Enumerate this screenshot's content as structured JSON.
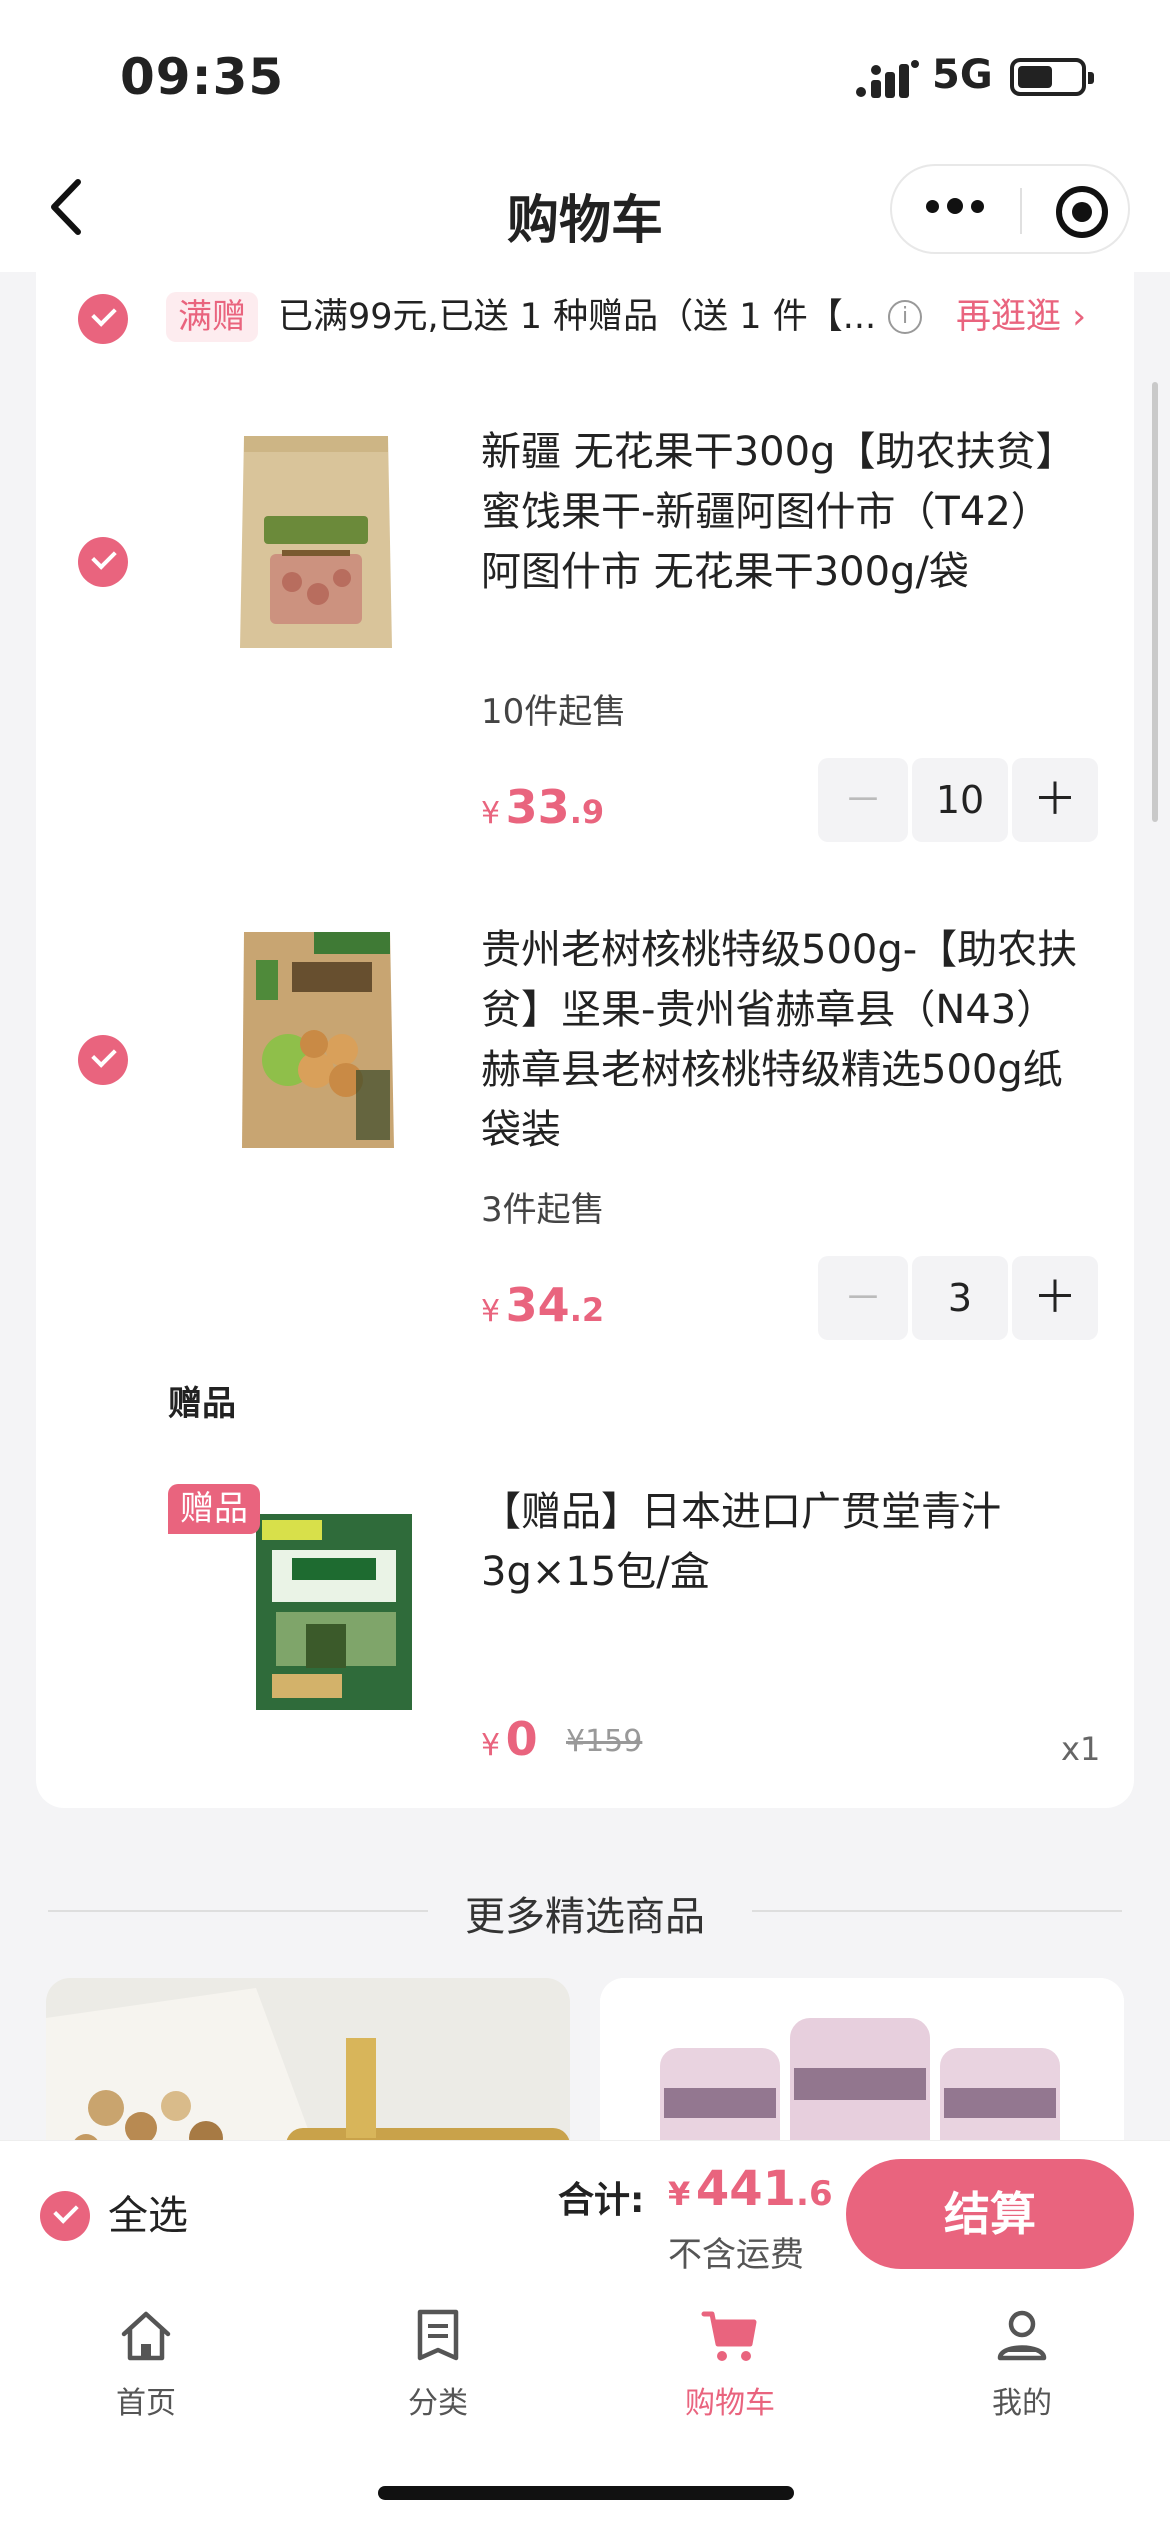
{
  "status_bar": {
    "time": "09:35",
    "network": "5G"
  },
  "nav": {
    "title": "购物车"
  },
  "promo": {
    "tag": "满赠",
    "text": "已满99元,已送 1 种赠品（送 1 件【...",
    "more": "再逛逛"
  },
  "items": [
    {
      "title": "新疆 无花果干300g【助农扶贫】蜜饯果干-新疆阿图什市（T42） 阿图什市 无花果干300g/袋",
      "min_qty": "10件起售",
      "price_currency": "¥",
      "price_int": "33",
      "price_dec": ".9",
      "qty": "10",
      "image": "dried-fig-package"
    },
    {
      "title": "贵州老树核桃特级500g-【助农扶贫】坚果-贵州省赫章县（N43） 赫章县老树核桃特级精选500g纸袋装",
      "min_qty": "3件起售",
      "price_currency": "¥",
      "price_int": "34",
      "price_dec": ".2",
      "qty": "3",
      "image": "walnut-package"
    }
  ],
  "gift": {
    "header": "赠品",
    "badge": "赠品",
    "title": "【赠品】日本进口广贯堂青汁3g×15包/盒",
    "price_currency": "¥",
    "price": "0",
    "original_price": "¥159",
    "count": "x1",
    "image": "aojiru-box"
  },
  "stepper": {
    "minus": "－",
    "plus": "＋"
  },
  "more_section": {
    "title": "更多精选商品"
  },
  "checkout": {
    "select_all": "全选",
    "total_label": "合计:",
    "total_currency": "¥",
    "total_int": "441",
    "total_dec": ".6",
    "shipping_note": "不含运费",
    "pay_button": "结算"
  },
  "tabbar": {
    "tabs": [
      {
        "label": "首页",
        "icon": "home-icon"
      },
      {
        "label": "分类",
        "icon": "list-icon"
      },
      {
        "label": "购物车",
        "icon": "cart-icon"
      },
      {
        "label": "我的",
        "icon": "user-icon"
      }
    ],
    "active_index": 2
  },
  "colors": {
    "accent": "#e9647e",
    "accent_light": "#fdecef",
    "background": "#f4f4f6"
  }
}
